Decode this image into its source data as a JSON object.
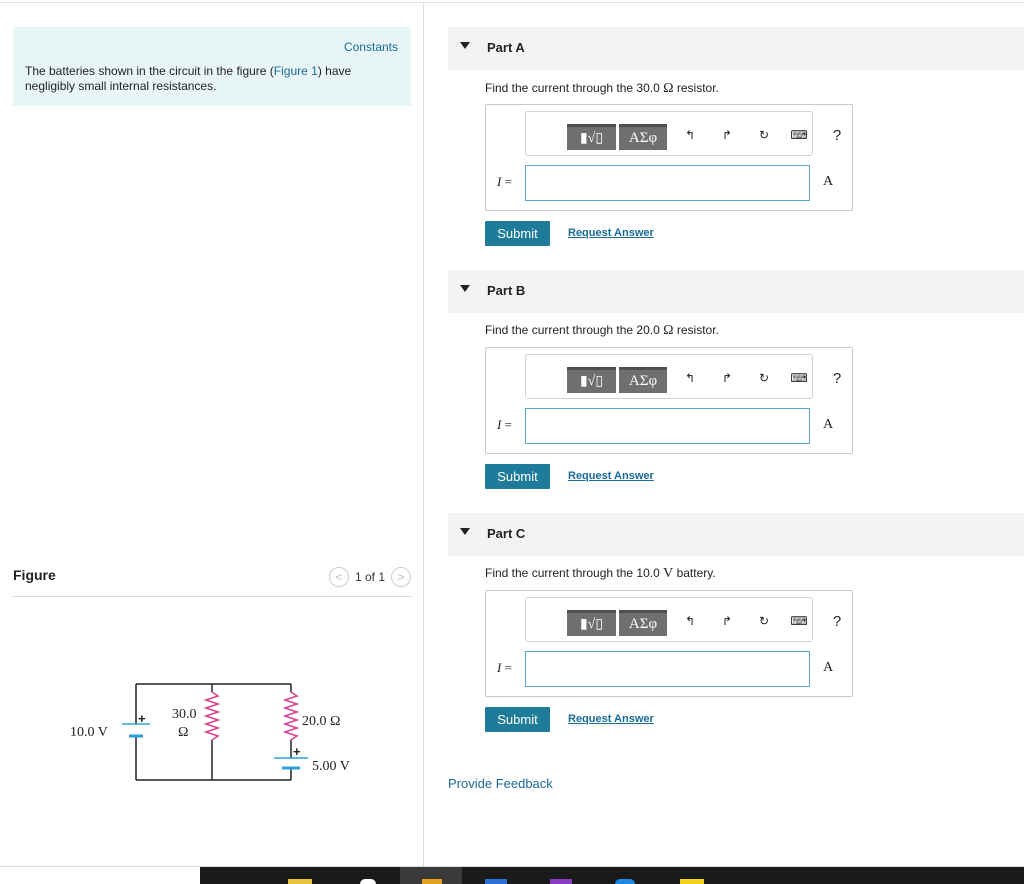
{
  "constants": {
    "label": "Constants"
  },
  "intro": {
    "text_before": "The batteries shown in the circuit in the figure (",
    "link": "Figure 1",
    "text_after": ") have negligibly small internal resistances."
  },
  "figure": {
    "title": "Figure",
    "pager": {
      "count": "1 of 1"
    },
    "circuit": {
      "battery_left_label": "10.0 V",
      "resistor_left_value": "30.0",
      "resistor_left_unit": "Ω",
      "resistor_right_label": "20.0 Ω",
      "battery_right_label": "5.00 V",
      "plus": "+"
    }
  },
  "toolbar": {
    "template_glyph": "▮√▯",
    "greek_label": "ΑΣφ",
    "undo": "↰",
    "redo": "↱",
    "reset": "↻",
    "keyboard": "⌨",
    "help": "?"
  },
  "parts": [
    {
      "label": "Part A",
      "question_before": "Find the current through the 30.0 ",
      "question_symbol": "Ω",
      "question_after": " resistor.",
      "var_name": "I",
      "eq": " =",
      "input_value": "",
      "unit": "A",
      "submit": "Submit",
      "request_answer": "Request Answer"
    },
    {
      "label": "Part B",
      "question_before": "Find the current through the 20.0 ",
      "question_symbol": "Ω",
      "question_after": " resistor.",
      "var_name": "I",
      "eq": " =",
      "input_value": "",
      "unit": "A",
      "submit": "Submit",
      "request_answer": "Request Answer"
    },
    {
      "label": "Part C",
      "question_before": "Find the current through the 10.0 ",
      "question_symbol": "V",
      "question_after": " battery.",
      "var_name": "I",
      "eq": " =",
      "input_value": "",
      "unit": "A",
      "submit": "Submit",
      "request_answer": "Request Answer"
    }
  ],
  "feedback": {
    "label": "Provide Feedback"
  },
  "colors": {
    "accent": "#1e7c9a",
    "link": "#1a6a9a",
    "intro_bg": "#e8f5f6",
    "part_header_bg": "#f3f3f3",
    "resistor": "#d4418a",
    "battery": "#2aa0d8"
  }
}
